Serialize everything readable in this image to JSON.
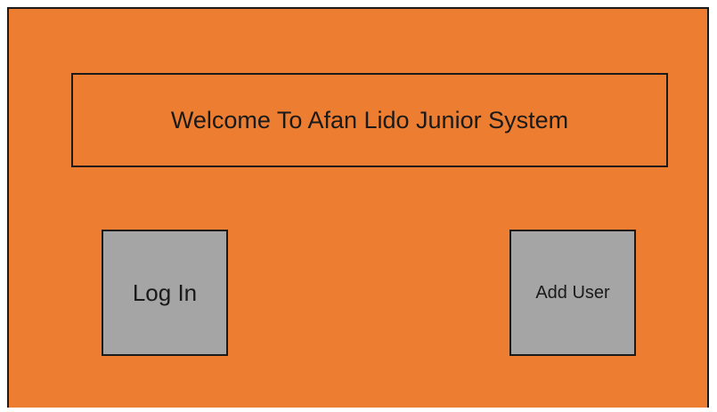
{
  "welcome": {
    "title": "Welcome To Afan Lido Junior System"
  },
  "actions": {
    "login_label": "Log In",
    "add_user_label": "Add User"
  },
  "colors": {
    "background": "#ED7D31",
    "button": "#A5A5A5",
    "border": "#1a1a1a"
  }
}
